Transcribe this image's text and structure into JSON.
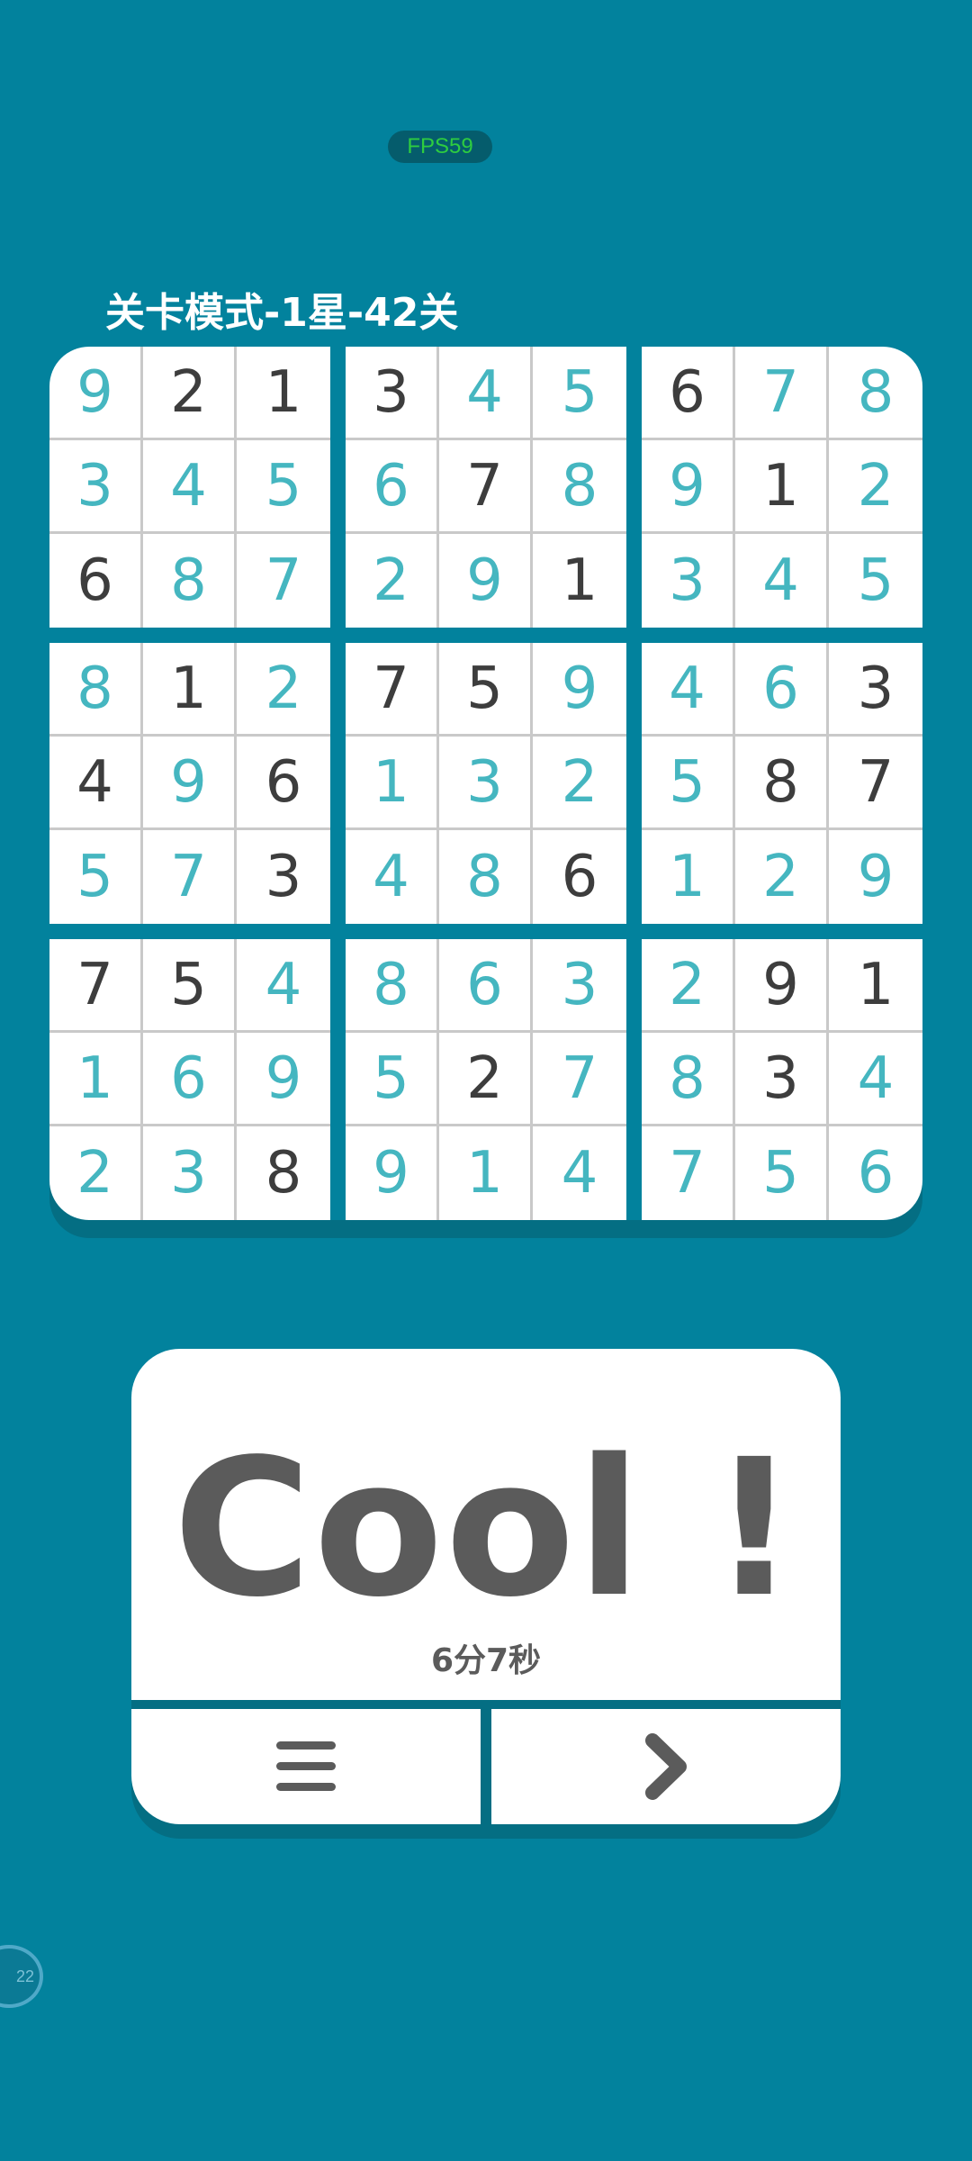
{
  "fps_badge": "FPS59",
  "level_title": "关卡模式-1星-42关",
  "board": {
    "rows": [
      [
        9,
        2,
        1,
        3,
        4,
        5,
        6,
        7,
        8
      ],
      [
        3,
        4,
        5,
        6,
        7,
        8,
        9,
        1,
        2
      ],
      [
        6,
        8,
        7,
        2,
        9,
        1,
        3,
        4,
        5
      ],
      [
        8,
        1,
        2,
        7,
        5,
        9,
        4,
        6,
        3
      ],
      [
        4,
        9,
        6,
        1,
        3,
        2,
        5,
        8,
        7
      ],
      [
        5,
        7,
        3,
        4,
        8,
        6,
        1,
        2,
        9
      ],
      [
        7,
        5,
        4,
        8,
        6,
        3,
        2,
        9,
        1
      ],
      [
        1,
        6,
        9,
        5,
        2,
        7,
        8,
        3,
        4
      ],
      [
        2,
        3,
        8,
        9,
        1,
        4,
        7,
        5,
        6
      ]
    ],
    "given": [
      [
        false,
        true,
        true,
        true,
        false,
        false,
        true,
        false,
        false
      ],
      [
        false,
        false,
        false,
        false,
        true,
        false,
        false,
        true,
        false
      ],
      [
        true,
        false,
        false,
        false,
        false,
        true,
        false,
        false,
        false
      ],
      [
        false,
        true,
        false,
        true,
        true,
        false,
        false,
        false,
        true
      ],
      [
        true,
        false,
        true,
        false,
        false,
        false,
        false,
        true,
        true
      ],
      [
        false,
        false,
        true,
        false,
        false,
        true,
        false,
        false,
        false
      ],
      [
        true,
        true,
        false,
        false,
        false,
        false,
        false,
        true,
        true
      ],
      [
        false,
        false,
        false,
        false,
        true,
        false,
        false,
        true,
        false
      ],
      [
        false,
        false,
        true,
        false,
        false,
        false,
        false,
        false,
        false
      ]
    ]
  },
  "colors": {
    "background": "#02829d",
    "given_digit": "#3d3d3d",
    "filled_digit": "#45b6c0",
    "card_text": "#5b5b5b"
  },
  "result": {
    "message": "Cool !",
    "time": "6分7秒"
  },
  "buttons": {
    "menu_icon": "menu-icon",
    "next_icon": "chevron-right-icon"
  },
  "float_ball_label": "22"
}
